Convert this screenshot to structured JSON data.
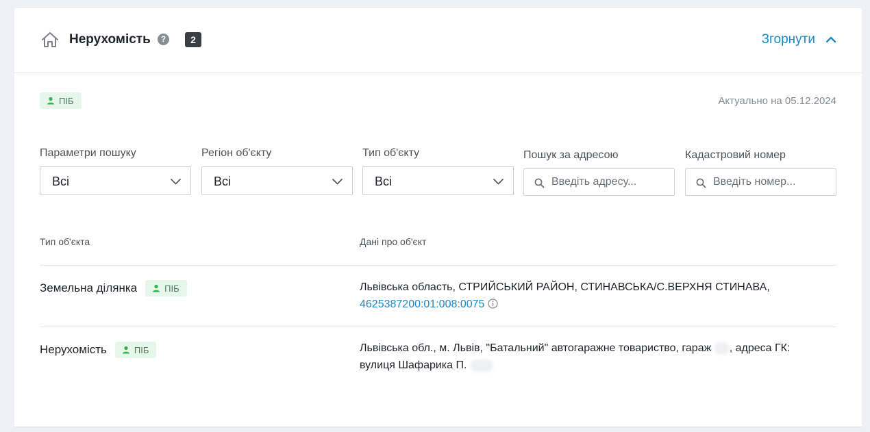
{
  "header": {
    "title": "Нерухомість",
    "help": "?",
    "count": "2",
    "collapse_label": "Згорнути"
  },
  "pib_tag": "ПІБ",
  "actual_date": "Актуально на 05.12.2024",
  "filters": {
    "search_params": {
      "label": "Параметри пошуку",
      "value": "Всі"
    },
    "region": {
      "label": "Регіон об'єкту",
      "value": "Всі"
    },
    "object_type": {
      "label": "Тип об'єкту",
      "value": "Всі"
    },
    "address": {
      "label": "Пошук за адресою",
      "placeholder": "Введіть адресу..."
    },
    "cadastral": {
      "label": "Кадастровий номер",
      "placeholder": "Введіть номер..."
    }
  },
  "table": {
    "col_type": "Тип об'єкта",
    "col_data": "Дані про об'єкт",
    "rows": [
      {
        "type": "Земельна ділянка",
        "tag": "ПІБ",
        "data_line1": "Львівська область, СТРИЙСЬКИЙ РАЙОН, СТИНАВСЬКА/С.ВЕРХНЯ СТИНАВА,",
        "cadastral_link": "4625387200:01:008:0075"
      },
      {
        "type": "Нерухомість",
        "tag": "ПІБ",
        "data_line1_a": "Львівська обл., м. Львів, \"Батальний\" автогаражне товариство, гараж",
        "data_line1_b": ", адреса ГК:",
        "data_line2": "вулиця Шафарика П."
      }
    ]
  },
  "colors": {
    "accent": "#1a87c6",
    "tag_bg": "#e6f6ea",
    "tag_icon": "#2fb34a",
    "badge_bg": "#3b3f45"
  }
}
